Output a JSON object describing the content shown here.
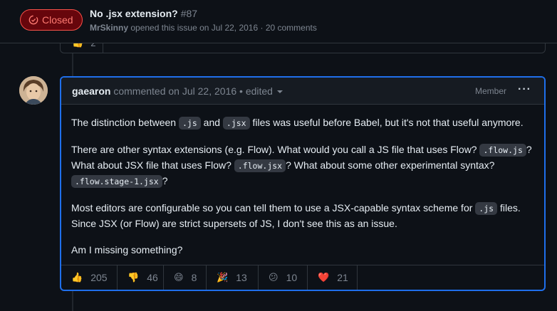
{
  "issue": {
    "state": "Closed",
    "title": "No .jsx extension?",
    "number": "#87",
    "author": "MrSkinny",
    "opened_text": "opened this issue on Jul 22, 2016 · 20 comments"
  },
  "previous_reaction": {
    "icon": "thumbs-up",
    "count": "2"
  },
  "comment": {
    "author": "gaearon",
    "action": "commented on Jul 22, 2016",
    "edited": "• edited",
    "role": "Member",
    "paragraphs": [
      {
        "p1a": "The distinction between ",
        "c1": ".js",
        "p1b": " and ",
        "c2": ".jsx",
        "p1c": " files was useful before Babel, but it's not that useful anymore."
      },
      {
        "p2a": "There are other syntax extensions (e.g. Flow). What would you call a JS file that uses Flow? ",
        "c1": ".flow.js",
        "p2b": "? What about JSX file that uses Flow? ",
        "c2": ".flow.jsx",
        "p2c": "? What about some other experimental syntax? ",
        "c3": ".flow.stage-1.jsx",
        "p2d": "?"
      },
      {
        "p3a": "Most editors are configurable so you can tell them to use a JSX-capable syntax scheme for ",
        "c1": ".js",
        "p3b": " files. Since JSX (or Flow) are strict supersets of JS, I don't see this as an issue."
      },
      {
        "p4": "Am I missing something?"
      }
    ],
    "reactions": [
      {
        "emoji": "👍",
        "name": "thumbs-up",
        "count": "205"
      },
      {
        "emoji": "👎",
        "name": "thumbs-down",
        "count": "46"
      },
      {
        "emoji": "😄",
        "name": "laugh",
        "count": "8"
      },
      {
        "emoji": "🎉",
        "name": "hooray",
        "count": "13"
      },
      {
        "emoji": "😕",
        "name": "confused",
        "count": "10"
      },
      {
        "emoji": "❤️",
        "name": "heart",
        "count": "21"
      }
    ]
  },
  "colors": {
    "accent": "#1f6feb",
    "closed": "#f85149",
    "bg": "#0d1117"
  }
}
